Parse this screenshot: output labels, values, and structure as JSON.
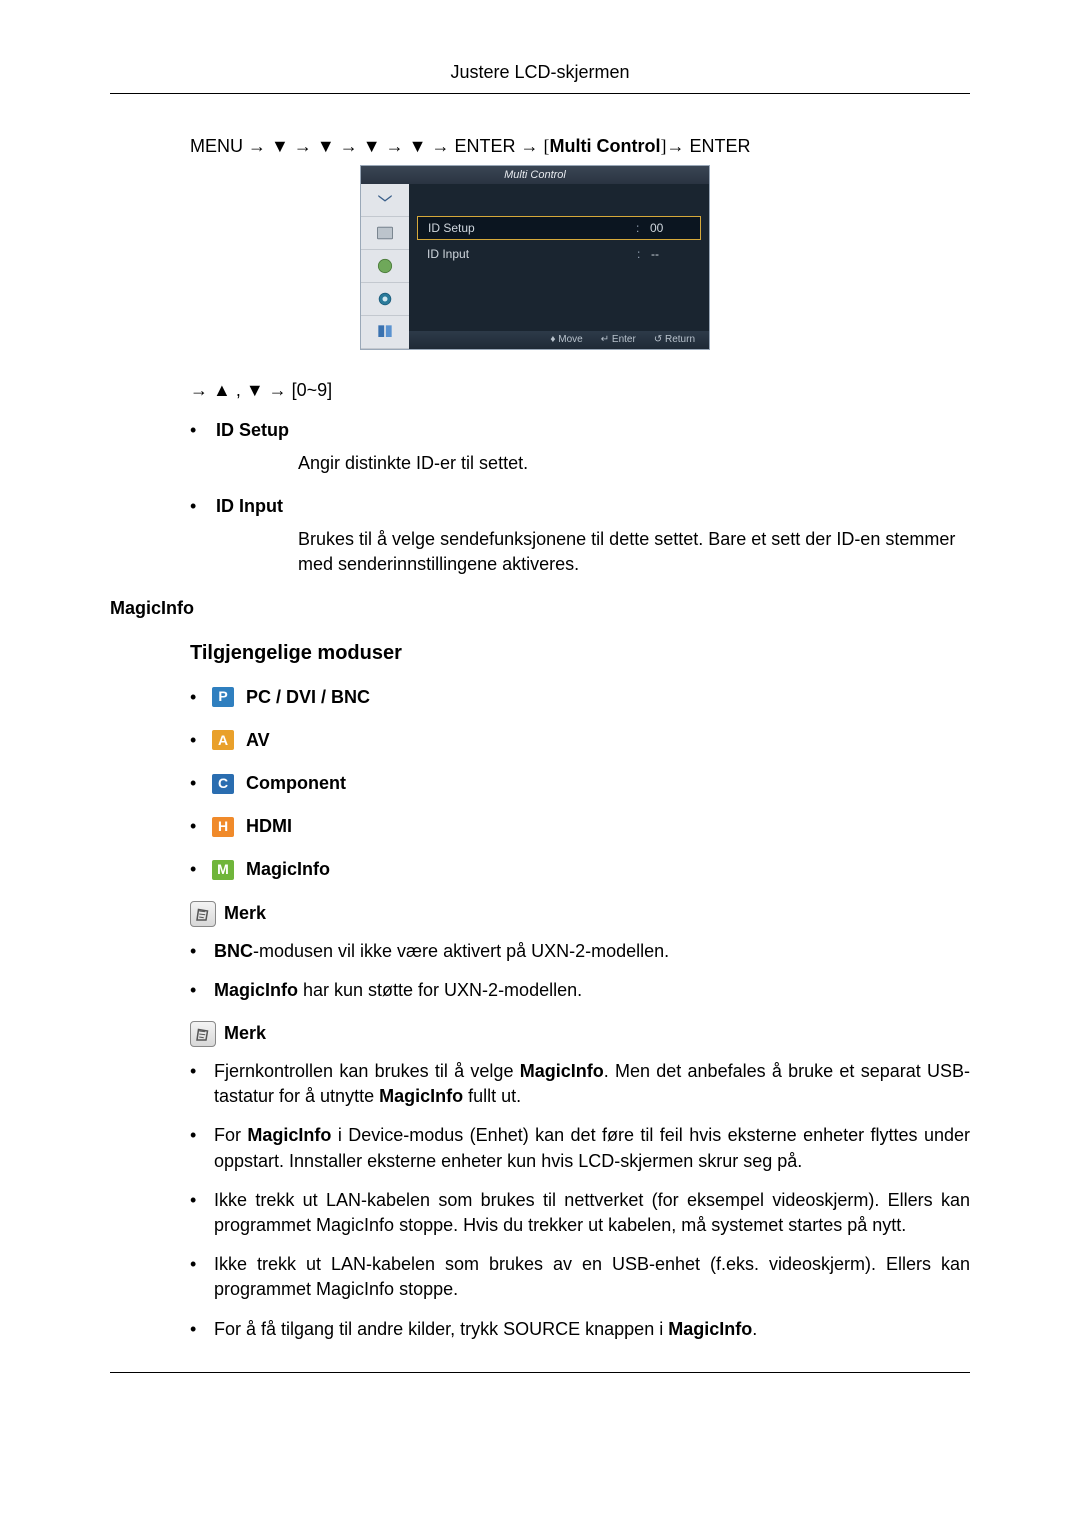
{
  "header": {
    "title": "Justere LCD-skjermen"
  },
  "path": {
    "menu": "MENU",
    "arrow": "→",
    "down": "▼",
    "enter": "ENTER",
    "multi": "Multi Control"
  },
  "osd": {
    "title": "Multi Control",
    "rows": [
      {
        "label": "ID Setup",
        "colon": ":",
        "val": "00",
        "selected": true
      },
      {
        "label": "ID Input",
        "colon": ":",
        "val": "--",
        "selected": false
      }
    ],
    "footer": {
      "move": "Move",
      "enter": "Enter",
      "return": "Return"
    }
  },
  "arrowNote": {
    "prefix": "→ ▲ , ▼ → ",
    "range": "[0~9]"
  },
  "idSetup": {
    "title": "ID Setup",
    "body": "Angir distinkte ID-er til settet."
  },
  "idInput": {
    "title": "ID Input",
    "body": "Brukes til å velge sendefunksjonene til dette settet. Bare et sett der ID-en stemmer med senderinnstillingene aktiveres."
  },
  "section": {
    "title": "MagicInfo"
  },
  "subTitle": "Tilgjengelige moduser",
  "modes": {
    "p": {
      "letter": "P",
      "label": "PC / DVI / BNC"
    },
    "a": {
      "letter": "A",
      "label": "AV"
    },
    "c": {
      "letter": "C",
      "label": "Component"
    },
    "h": {
      "letter": "H",
      "label": "HDMI"
    },
    "m": {
      "letter": "M",
      "label": "MagicInfo"
    }
  },
  "note": {
    "label": "Merk"
  },
  "notes1": {
    "n1a": "BNC",
    "n1b": "-modusen vil ikke være aktivert på UXN-2-modellen.",
    "n2a": "MagicInfo",
    "n2b": " har kun støtte for UXN-2-modellen."
  },
  "notes2": {
    "n1a": "Fjernkontrollen kan brukes til å velge ",
    "n1b": "MagicInfo",
    "n1c": ". Men det anbefales å bruke et separat USB-tastatur for å utnytte ",
    "n1d": "MagicInfo",
    "n1e": " fullt ut.",
    "n2a": "For ",
    "n2b": "MagicInfo",
    "n2c": " i Device-modus (Enhet) kan det føre til feil hvis eksterne enheter flyttes under oppstart. Innstaller eksterne enheter kun hvis LCD-skjermen skrur seg på.",
    "n3": "Ikke trekk ut LAN-kabelen som brukes til nettverket (for eksempel videoskjerm). Ellers kan programmet MagicInfo stoppe. Hvis du trekker ut kabelen, må systemet startes på nytt.",
    "n4": "Ikke trekk ut LAN-kabelen som brukes av en USB-enhet (f.eks. videoskjerm). Ellers kan programmet MagicInfo stoppe.",
    "n5a": "For å få tilgang til andre kilder, trykk SOURCE knappen i ",
    "n5b": "MagicInfo",
    "n5c": "."
  },
  "bullet": "•"
}
